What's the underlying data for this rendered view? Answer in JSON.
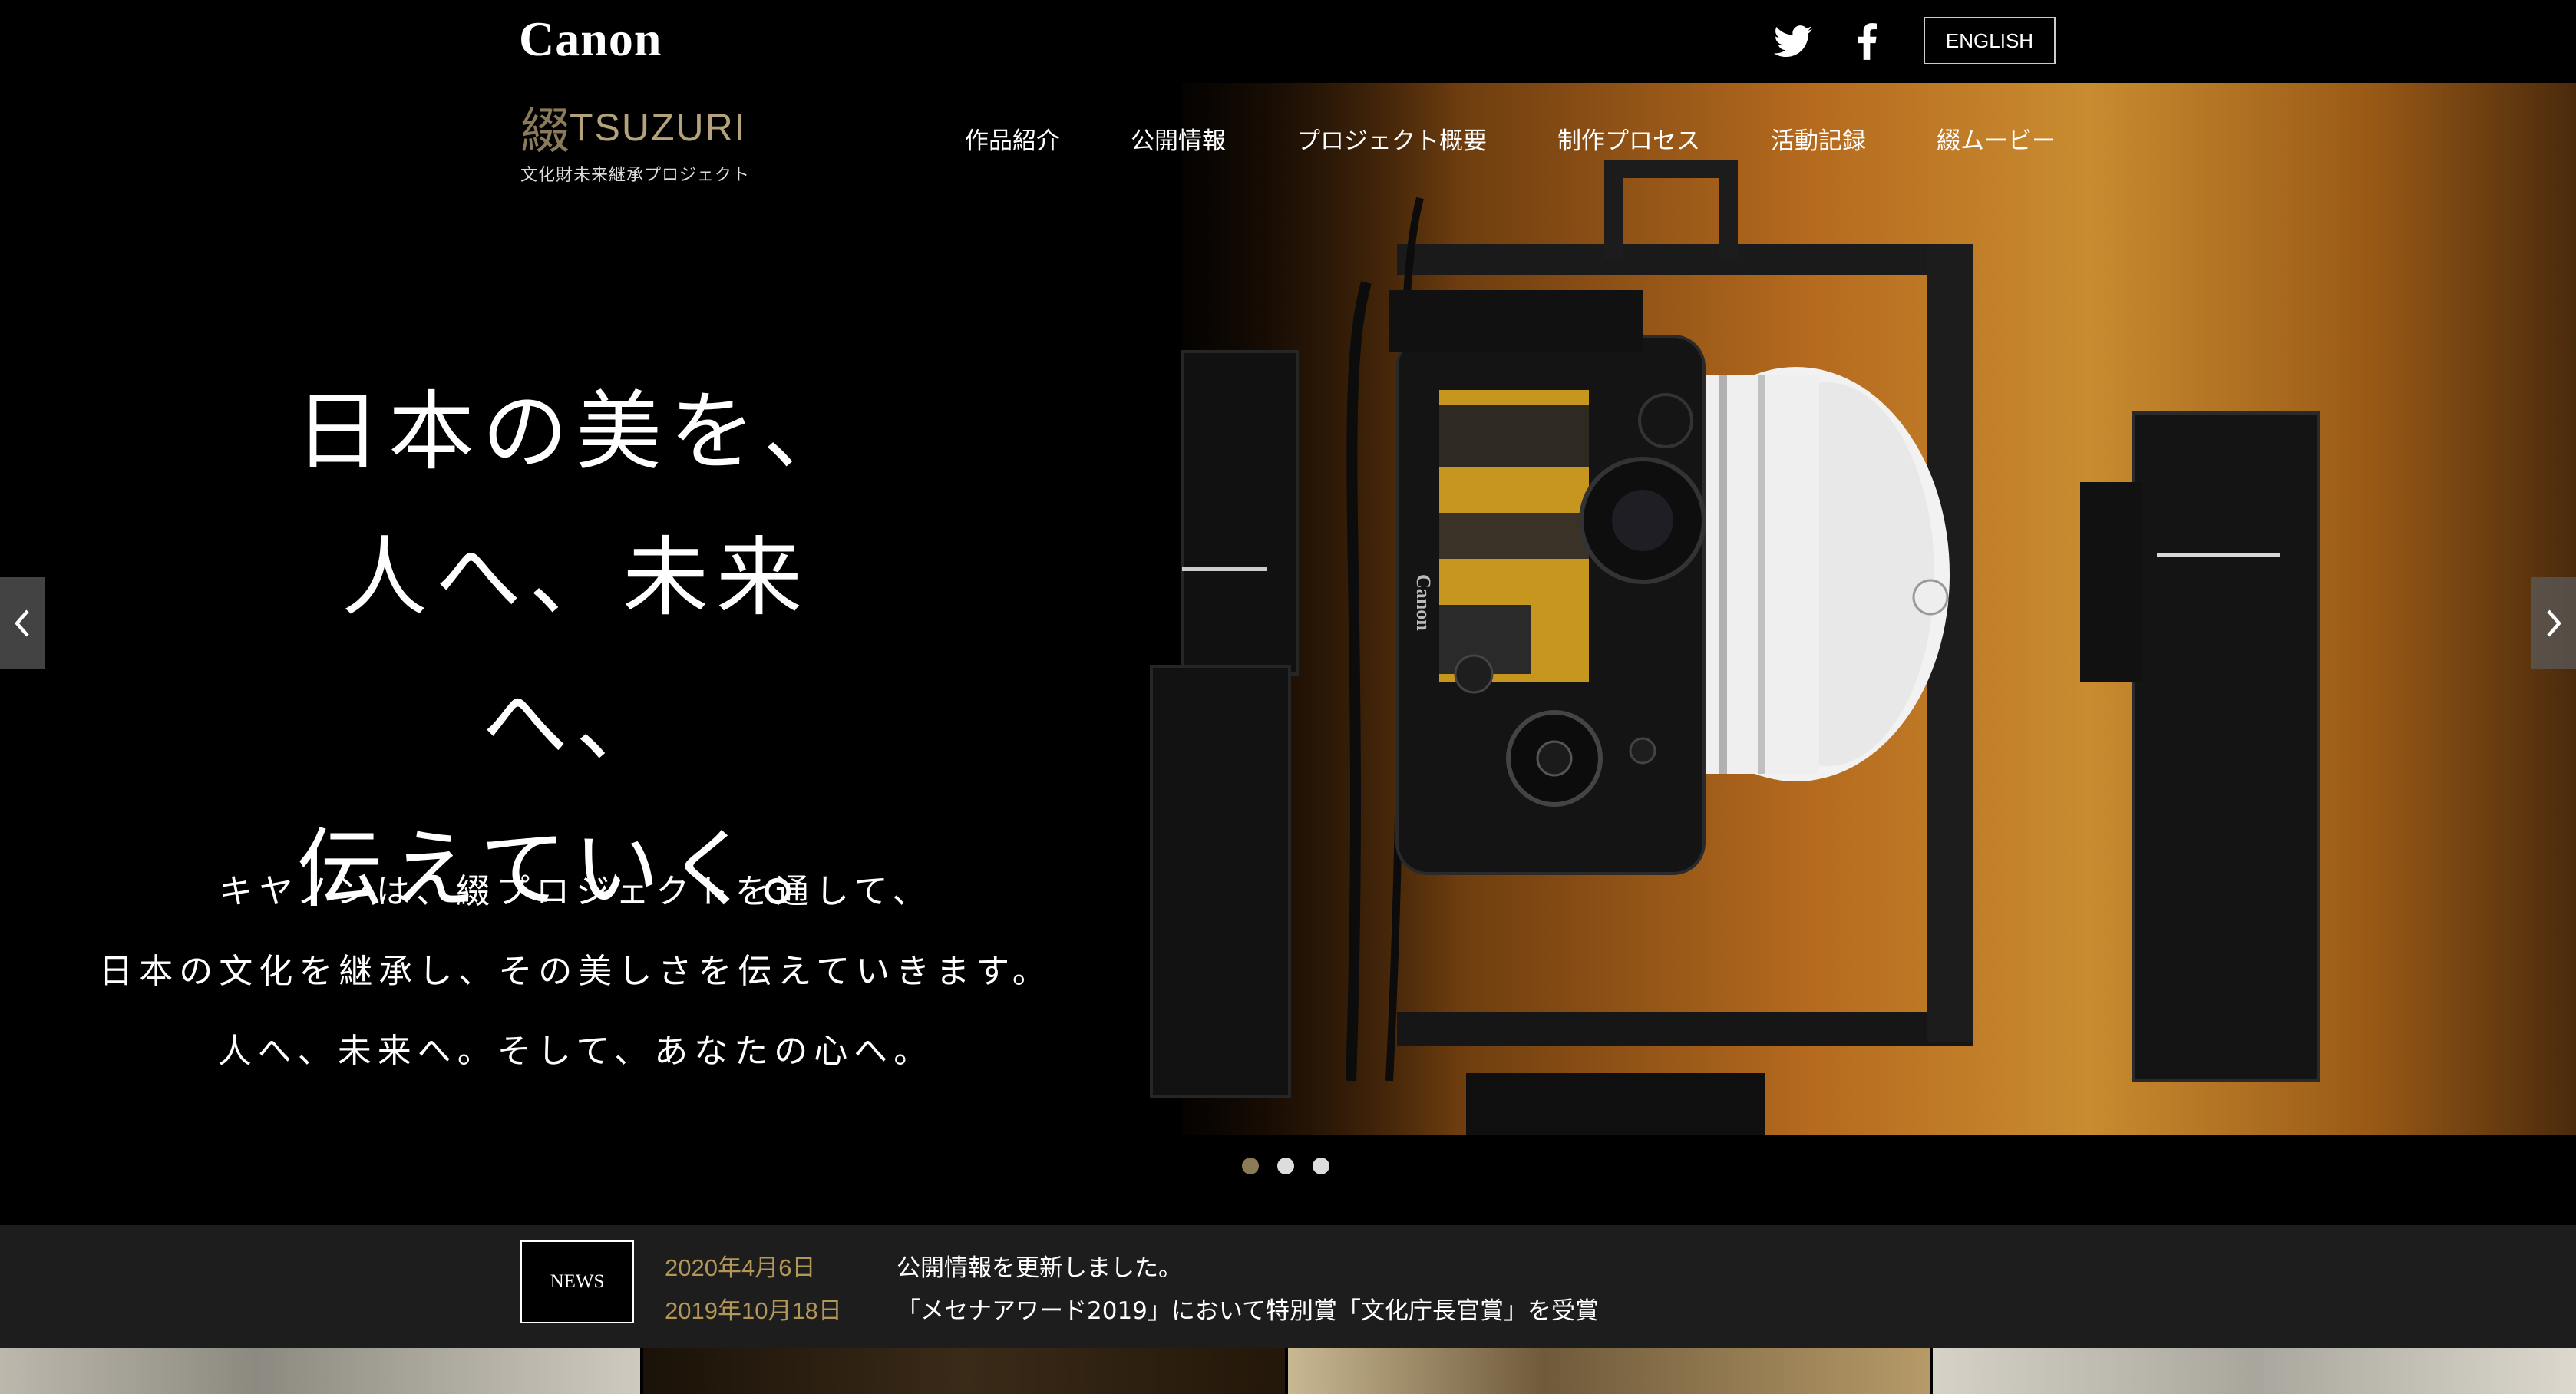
{
  "header": {
    "brand": "Canon",
    "social": {
      "twitter_icon": "twitter-icon",
      "facebook_icon": "facebook-icon"
    },
    "language_button": "ENGLISH",
    "project_logo": {
      "kanji": "綴",
      "name": "TSUZURI",
      "subtitle": "文化財未来継承プロジェクト"
    },
    "nav": [
      "作品紹介",
      "公開情報",
      "プロジェクト概要",
      "制作プロセス",
      "活動記録",
      "綴ムービー"
    ]
  },
  "hero": {
    "headline": [
      "日本の美を、",
      "人へ、未来へ、",
      "伝えていく。"
    ],
    "body": [
      "キヤノンは、綴プロジェクトを通して、",
      "日本の文化を継承し、その美しさを伝えていきます。",
      "人へ、未来へ。そして、あなたの心へ。"
    ],
    "camera_brand": "Canon",
    "slides_total": 3,
    "slide_active": 1,
    "prev_icon": "chevron-left-icon",
    "next_icon": "chevron-right-icon"
  },
  "news": {
    "label": "NEWS",
    "items": [
      {
        "date": "2020年4月6日",
        "text": "公開情報を更新しました。"
      },
      {
        "date": "2019年10月18日",
        "text": "「メセナアワード2019」において特別賞「文化庁長官賞」を受賞"
      }
    ]
  },
  "colors": {
    "background": "#000000",
    "accent_gold": "#b39758",
    "news_bar": "#1d1d1d"
  }
}
